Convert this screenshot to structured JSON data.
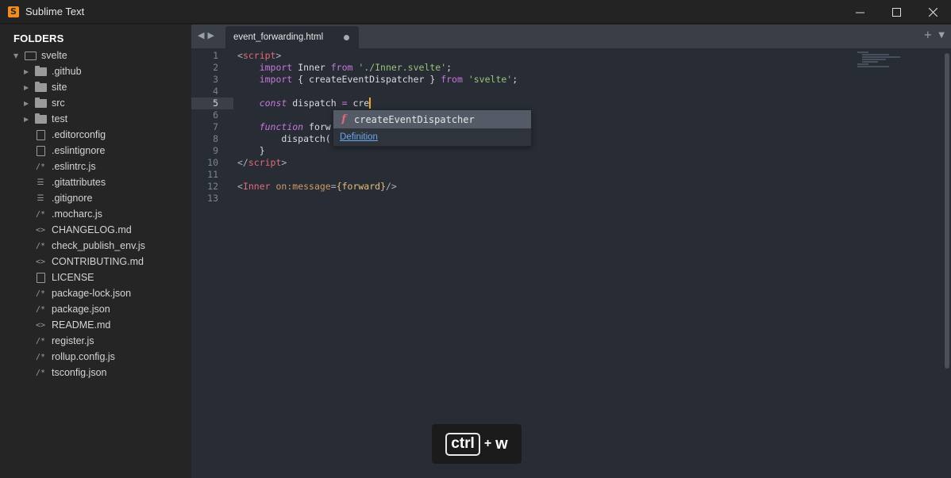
{
  "window": {
    "title": "Sublime Text",
    "logo_letter": "S",
    "controls": [
      "minimize",
      "maximize",
      "close"
    ]
  },
  "sidebar": {
    "heading": "FOLDERS",
    "root": {
      "label": "svelte",
      "icon": "folder-open-icon",
      "expanded": true
    },
    "items": [
      {
        "label": ".github",
        "icon": "folder-icon",
        "type": "folder"
      },
      {
        "label": "site",
        "icon": "folder-icon",
        "type": "folder"
      },
      {
        "label": "src",
        "icon": "folder-icon",
        "type": "folder"
      },
      {
        "label": "test",
        "icon": "folder-icon",
        "type": "folder"
      },
      {
        "label": ".editorconfig",
        "icon": "file-icon",
        "type": "file"
      },
      {
        "label": ".eslintignore",
        "icon": "file-icon",
        "type": "file"
      },
      {
        "label": ".eslintrc.js",
        "icon": "js-file-icon",
        "type": "file"
      },
      {
        "label": ".gitattributes",
        "icon": "text-file-icon",
        "type": "file"
      },
      {
        "label": ".gitignore",
        "icon": "text-file-icon",
        "type": "file"
      },
      {
        "label": ".mocharc.js",
        "icon": "js-file-icon",
        "type": "file"
      },
      {
        "label": "CHANGELOG.md",
        "icon": "markup-file-icon",
        "type": "file"
      },
      {
        "label": "check_publish_env.js",
        "icon": "js-file-icon",
        "type": "file"
      },
      {
        "label": "CONTRIBUTING.md",
        "icon": "markup-file-icon",
        "type": "file"
      },
      {
        "label": "LICENSE",
        "icon": "file-icon",
        "type": "file"
      },
      {
        "label": "package-lock.json",
        "icon": "js-file-icon",
        "type": "file"
      },
      {
        "label": "package.json",
        "icon": "js-file-icon",
        "type": "file"
      },
      {
        "label": "README.md",
        "icon": "markup-file-icon",
        "type": "file"
      },
      {
        "label": "register.js",
        "icon": "js-file-icon",
        "type": "file"
      },
      {
        "label": "rollup.config.js",
        "icon": "js-file-icon",
        "type": "file"
      },
      {
        "label": "tsconfig.json",
        "icon": "js-file-icon",
        "type": "file"
      }
    ]
  },
  "tabs": [
    {
      "label": "event_forwarding.html",
      "dirty": true,
      "active": true
    }
  ],
  "editor": {
    "active_line": "5",
    "lines": [
      {
        "n": "1",
        "tokens": [
          {
            "t": "<",
            "c": "br"
          },
          {
            "t": "script",
            "c": "tag"
          },
          {
            "t": ">",
            "c": "br"
          }
        ]
      },
      {
        "n": "2",
        "tokens": [
          {
            "t": "    ",
            "c": ""
          },
          {
            "t": "import",
            "c": "kw"
          },
          {
            "t": " Inner ",
            "c": ""
          },
          {
            "t": "from",
            "c": "kw"
          },
          {
            "t": " ",
            "c": ""
          },
          {
            "t": "'./Inner.svelte'",
            "c": "str"
          },
          {
            "t": ";",
            "c": ""
          }
        ]
      },
      {
        "n": "3",
        "tokens": [
          {
            "t": "    ",
            "c": ""
          },
          {
            "t": "import",
            "c": "kw"
          },
          {
            "t": " { createEventDispatcher } ",
            "c": ""
          },
          {
            "t": "from",
            "c": "kw"
          },
          {
            "t": " ",
            "c": ""
          },
          {
            "t": "'svelte'",
            "c": "str"
          },
          {
            "t": ";",
            "c": ""
          }
        ]
      },
      {
        "n": "4",
        "tokens": []
      },
      {
        "n": "5",
        "tokens": [
          {
            "t": "    ",
            "c": ""
          },
          {
            "t": "const",
            "c": "kwi"
          },
          {
            "t": " dispatch ",
            "c": ""
          },
          {
            "t": "=",
            "c": "kw"
          },
          {
            "t": " cre",
            "c": ""
          }
        ],
        "cursor": true
      },
      {
        "n": "6",
        "tokens": []
      },
      {
        "n": "7",
        "tokens": [
          {
            "t": "    ",
            "c": ""
          },
          {
            "t": "function",
            "c": "kwi"
          },
          {
            "t": " forw",
            "c": ""
          }
        ]
      },
      {
        "n": "8",
        "tokens": [
          {
            "t": "        dispatch(",
            "c": ""
          }
        ]
      },
      {
        "n": "9",
        "tokens": [
          {
            "t": "    }",
            "c": ""
          }
        ]
      },
      {
        "n": "10",
        "tokens": [
          {
            "t": "</",
            "c": "br"
          },
          {
            "t": "script",
            "c": "tag"
          },
          {
            "t": ">",
            "c": "br"
          }
        ]
      },
      {
        "n": "11",
        "tokens": []
      },
      {
        "n": "12",
        "tokens": [
          {
            "t": "<",
            "c": "br"
          },
          {
            "t": "Inner",
            "c": "tag"
          },
          {
            "t": " ",
            "c": ""
          },
          {
            "t": "on:message",
            "c": "attr"
          },
          {
            "t": "=",
            "c": "br"
          },
          {
            "t": "{forward}",
            "c": "brace"
          },
          {
            "t": "/>",
            "c": "br"
          }
        ]
      },
      {
        "n": "13",
        "tokens": []
      }
    ]
  },
  "autocomplete": {
    "kind": "f",
    "suggestion": "createEventDispatcher",
    "footer_link": "Definition"
  },
  "key_overlay": {
    "modifier": "ctrl",
    "plus": "+",
    "key": "w"
  },
  "colors": {
    "editor_bg": "#282c34",
    "sidebar_bg": "#252526",
    "cursor": "#f5a623",
    "keyword": "#c678dd",
    "string": "#98c379",
    "tag": "#e06c75"
  }
}
